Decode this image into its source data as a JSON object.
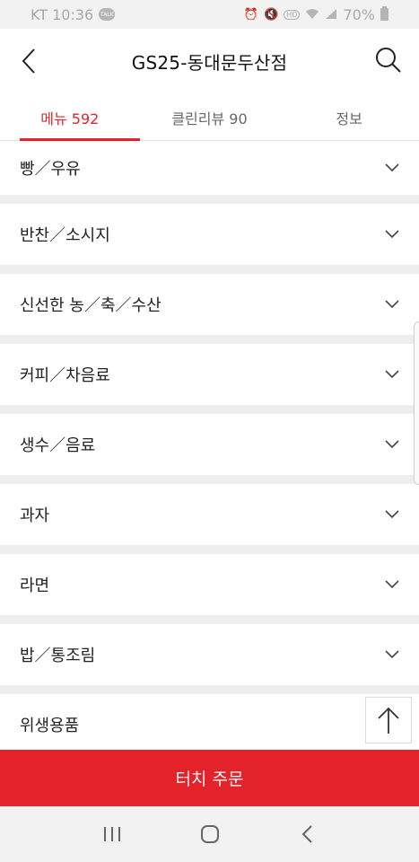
{
  "status_bar": {
    "carrier_time": "KT 10:36",
    "chat_icon_label": "TALK",
    "signal_text": "70%",
    "icons": [
      "alarm-icon",
      "mute-icon",
      "hd-icon",
      "wifi-icon",
      "signal-icon",
      "battery-icon"
    ]
  },
  "header": {
    "title": "GS25-동대문두산점",
    "back_icon": "chevron-left-icon",
    "search_icon": "search-icon"
  },
  "tabs": [
    {
      "label": "메뉴 592",
      "active": true
    },
    {
      "label": "클린리뷰 90",
      "active": false
    },
    {
      "label": "정보",
      "active": false
    }
  ],
  "categories": [
    "빵／우유",
    "반찬／소시지",
    "신선한 농／축／수산",
    "커피／차음료",
    "생수／음료",
    "과자",
    "라면",
    "밥／통조림",
    "위생용품"
  ],
  "order_button": {
    "label": "터치 주문"
  },
  "scroll_top_button": {
    "icon": "arrow-up-icon"
  },
  "nav_bar": {
    "icons": [
      "recent-apps-icon",
      "home-icon",
      "back-icon"
    ]
  },
  "colors": {
    "accent": "#e4222a",
    "separator": "#eeeeee",
    "statusbar": "#f2f2f2"
  }
}
